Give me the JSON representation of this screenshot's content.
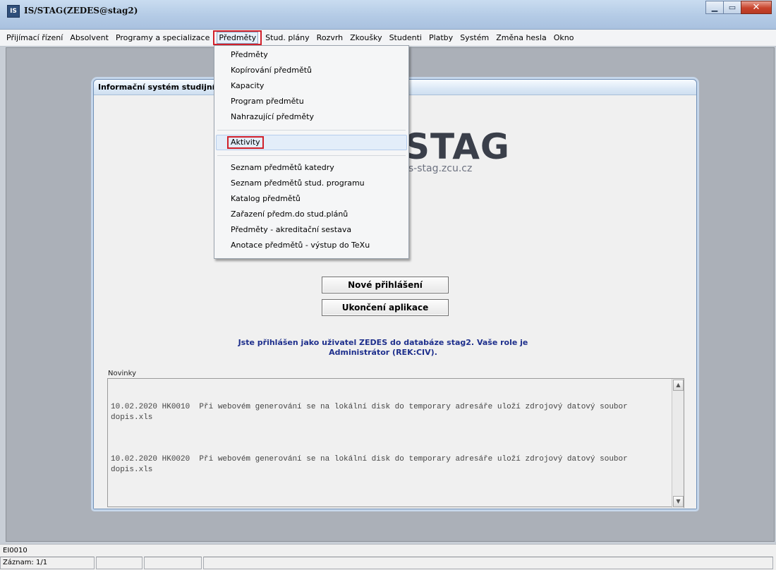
{
  "window": {
    "title": "IS/STAG(ZEDES@stag2)",
    "icon": "app-icon"
  },
  "menubar": {
    "items": [
      "Přijímací řízení",
      "Absolvent",
      "Programy a specializace",
      "Předměty",
      "Stud. plány",
      "Rozvrh",
      "Zkoušky",
      "Studenti",
      "Platby",
      "Systém",
      "Změna hesla",
      "Okno"
    ],
    "active": "Předměty"
  },
  "dropdown": {
    "group1": [
      "Předměty",
      "Kopírování předmětů",
      "Kapacity",
      "Program předmětu",
      "Nahrazující předměty"
    ],
    "highlighted": "Aktivity",
    "group2": [
      "Seznam předmětů katedry",
      "Seznam předmětů stud. programu",
      "Katalog předmětů",
      "Zařazení předm.do stud.plánů",
      "Předměty - akreditační sestava",
      "Anotace předmětů - výstup do TeXu"
    ]
  },
  "inner_window": {
    "title": "Informační systém studijní",
    "logo_text": "STAG",
    "logo_sub": "is-stag.zcu.cz",
    "login_button": "Nové přihlášení",
    "exit_button": "Ukončení aplikace",
    "user_info": "Jste přihlášen jako uživatel ZEDES do databáze stag2. Vaše role je Administrátor (REK:CIV).",
    "news_label": "Novinky",
    "news": [
      "10.02.2020 HK0010  Při webovém generování se na lokální disk do temporary adresáře uloží zdrojový datový soubor dopis.xls",
      "10.02.2020 HK0020  Při webovém generování se na lokální disk do temporary adresáře uloží zdrojový datový soubor dopis.xls"
    ]
  },
  "statusbar": {
    "code": "EI0010",
    "record": "Záznam: 1/1"
  }
}
